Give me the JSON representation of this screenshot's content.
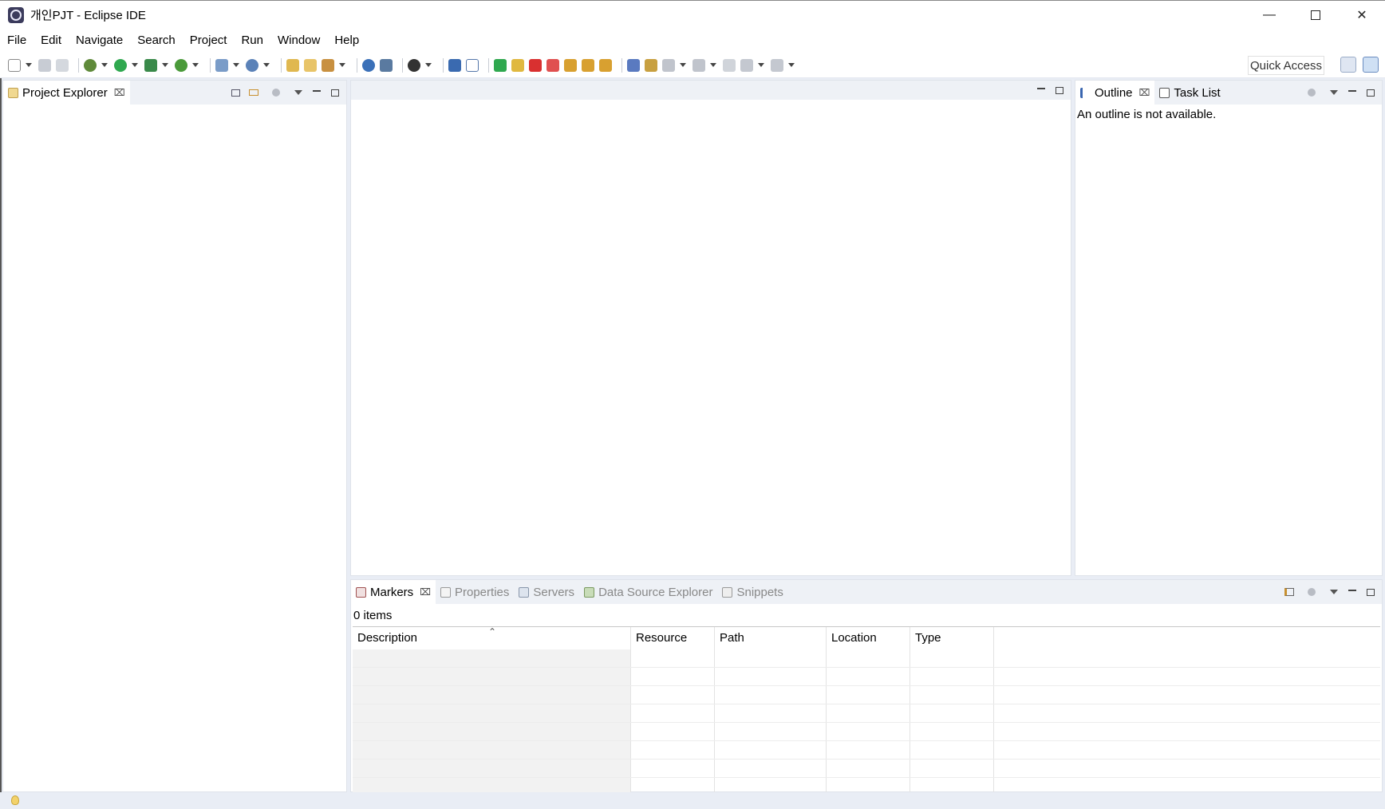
{
  "window": {
    "title": "개인PJT - Eclipse IDE",
    "controls": [
      "minimize",
      "maximize",
      "close"
    ]
  },
  "menu": [
    "File",
    "Edit",
    "Navigate",
    "Search",
    "Project",
    "Run",
    "Window",
    "Help"
  ],
  "toolbar": {
    "quick_access": "Quick Access"
  },
  "project_explorer": {
    "tab_label": "Project Explorer"
  },
  "outline": {
    "tabs": [
      {
        "label": "Outline",
        "active": true
      },
      {
        "label": "Task List",
        "active": false
      }
    ],
    "message": "An outline is not available."
  },
  "bottom_panel": {
    "tabs": [
      {
        "label": "Markers",
        "active": true
      },
      {
        "label": "Properties",
        "active": false
      },
      {
        "label": "Servers",
        "active": false
      },
      {
        "label": "Data Source Explorer",
        "active": false
      },
      {
        "label": "Snippets",
        "active": false
      }
    ],
    "items_count": "0 items",
    "columns": [
      "Description",
      "Resource",
      "Path",
      "Location",
      "Type"
    ]
  },
  "colors": {
    "workspace_bg": "#e9edf5",
    "run_green": "#2fa84f",
    "stop_red": "#d93030"
  }
}
